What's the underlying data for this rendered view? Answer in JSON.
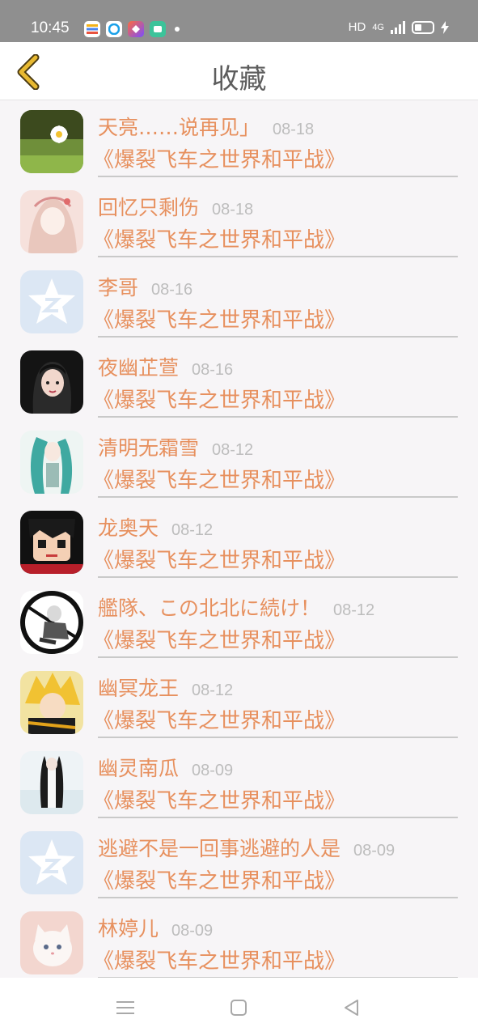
{
  "status_bar": {
    "time": "10:45",
    "hd": "HD",
    "network": "4G"
  },
  "header": {
    "title": "收藏"
  },
  "items": [
    {
      "name": "天亮……说再见」",
      "date": "08-18",
      "message": "《爆裂飞车之世界和平战》",
      "avatar": "daisy-avatar"
    },
    {
      "name": "回忆只剩伤",
      "date": "08-18",
      "message": "《爆裂飞车之世界和平战》",
      "avatar": "anime-girl-avatar"
    },
    {
      "name": "李哥",
      "date": "08-16",
      "message": "《爆裂飞车之世界和平战》",
      "avatar": "default-qq-avatar"
    },
    {
      "name": "夜幽芷萱",
      "date": "08-16",
      "message": "《爆裂飞车之世界和平战》",
      "avatar": "girl-portrait-avatar"
    },
    {
      "name": "清明无霜雪",
      "date": "08-12",
      "message": "《爆裂飞车之世界和平战》",
      "avatar": "teal-hair-avatar"
    },
    {
      "name": "龙奥天",
      "date": "08-12",
      "message": "《爆裂飞车之世界和平战》",
      "avatar": "cartoon-boy-avatar"
    },
    {
      "name": "艦隊、この北北に続け！",
      "date": "08-12",
      "message": "《爆裂飞车之世界和平战》",
      "avatar": "monochrome-anime-avatar"
    },
    {
      "name": "幽冥龙王",
      "date": "08-12",
      "message": "《爆裂飞车之世界和平战》",
      "avatar": "blonde-anime-avatar"
    },
    {
      "name": "幽灵南瓜",
      "date": "08-09",
      "message": "《爆裂飞车之世界和平战》",
      "avatar": "long-hair-girl-avatar"
    },
    {
      "name": "逃避不是一回事逃避的人是",
      "date": "08-09",
      "message": "《爆裂飞车之世界和平战》",
      "avatar": "default-qq-avatar"
    },
    {
      "name": "林婷儿",
      "date": "08-09",
      "message": "《爆裂飞车之世界和平战》",
      "avatar": "white-cat-avatar"
    }
  ],
  "colors": {
    "accent": "#e7905e",
    "date": "#bdbdbd",
    "divider": "#c9c9c9",
    "back": "#e8b931"
  }
}
